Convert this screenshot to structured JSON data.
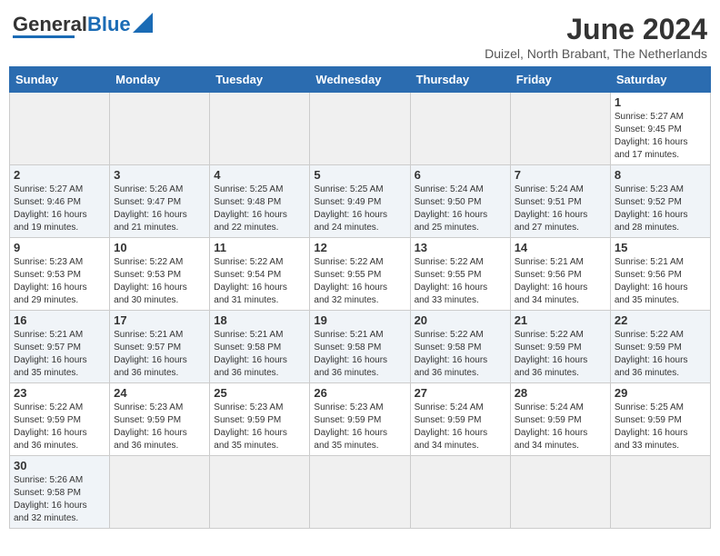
{
  "header": {
    "logo_general": "General",
    "logo_blue": "Blue",
    "month_year": "June 2024",
    "location": "Duizel, North Brabant, The Netherlands"
  },
  "weekdays": [
    "Sunday",
    "Monday",
    "Tuesday",
    "Wednesday",
    "Thursday",
    "Friday",
    "Saturday"
  ],
  "weeks": [
    [
      {
        "day": "",
        "info": ""
      },
      {
        "day": "",
        "info": ""
      },
      {
        "day": "",
        "info": ""
      },
      {
        "day": "",
        "info": ""
      },
      {
        "day": "",
        "info": ""
      },
      {
        "day": "",
        "info": ""
      },
      {
        "day": "1",
        "info": "Sunrise: 5:27 AM\nSunset: 9:45 PM\nDaylight: 16 hours\nand 17 minutes."
      }
    ],
    [
      {
        "day": "2",
        "info": "Sunrise: 5:27 AM\nSunset: 9:46 PM\nDaylight: 16 hours\nand 19 minutes."
      },
      {
        "day": "3",
        "info": "Sunrise: 5:26 AM\nSunset: 9:47 PM\nDaylight: 16 hours\nand 21 minutes."
      },
      {
        "day": "4",
        "info": "Sunrise: 5:25 AM\nSunset: 9:48 PM\nDaylight: 16 hours\nand 22 minutes."
      },
      {
        "day": "5",
        "info": "Sunrise: 5:25 AM\nSunset: 9:49 PM\nDaylight: 16 hours\nand 24 minutes."
      },
      {
        "day": "6",
        "info": "Sunrise: 5:24 AM\nSunset: 9:50 PM\nDaylight: 16 hours\nand 25 minutes."
      },
      {
        "day": "7",
        "info": "Sunrise: 5:24 AM\nSunset: 9:51 PM\nDaylight: 16 hours\nand 27 minutes."
      },
      {
        "day": "8",
        "info": "Sunrise: 5:23 AM\nSunset: 9:52 PM\nDaylight: 16 hours\nand 28 minutes."
      }
    ],
    [
      {
        "day": "9",
        "info": "Sunrise: 5:23 AM\nSunset: 9:53 PM\nDaylight: 16 hours\nand 29 minutes."
      },
      {
        "day": "10",
        "info": "Sunrise: 5:22 AM\nSunset: 9:53 PM\nDaylight: 16 hours\nand 30 minutes."
      },
      {
        "day": "11",
        "info": "Sunrise: 5:22 AM\nSunset: 9:54 PM\nDaylight: 16 hours\nand 31 minutes."
      },
      {
        "day": "12",
        "info": "Sunrise: 5:22 AM\nSunset: 9:55 PM\nDaylight: 16 hours\nand 32 minutes."
      },
      {
        "day": "13",
        "info": "Sunrise: 5:22 AM\nSunset: 9:55 PM\nDaylight: 16 hours\nand 33 minutes."
      },
      {
        "day": "14",
        "info": "Sunrise: 5:21 AM\nSunset: 9:56 PM\nDaylight: 16 hours\nand 34 minutes."
      },
      {
        "day": "15",
        "info": "Sunrise: 5:21 AM\nSunset: 9:56 PM\nDaylight: 16 hours\nand 35 minutes."
      }
    ],
    [
      {
        "day": "16",
        "info": "Sunrise: 5:21 AM\nSunset: 9:57 PM\nDaylight: 16 hours\nand 35 minutes."
      },
      {
        "day": "17",
        "info": "Sunrise: 5:21 AM\nSunset: 9:57 PM\nDaylight: 16 hours\nand 36 minutes."
      },
      {
        "day": "18",
        "info": "Sunrise: 5:21 AM\nSunset: 9:58 PM\nDaylight: 16 hours\nand 36 minutes."
      },
      {
        "day": "19",
        "info": "Sunrise: 5:21 AM\nSunset: 9:58 PM\nDaylight: 16 hours\nand 36 minutes."
      },
      {
        "day": "20",
        "info": "Sunrise: 5:22 AM\nSunset: 9:58 PM\nDaylight: 16 hours\nand 36 minutes."
      },
      {
        "day": "21",
        "info": "Sunrise: 5:22 AM\nSunset: 9:59 PM\nDaylight: 16 hours\nand 36 minutes."
      },
      {
        "day": "22",
        "info": "Sunrise: 5:22 AM\nSunset: 9:59 PM\nDaylight: 16 hours\nand 36 minutes."
      }
    ],
    [
      {
        "day": "23",
        "info": "Sunrise: 5:22 AM\nSunset: 9:59 PM\nDaylight: 16 hours\nand 36 minutes."
      },
      {
        "day": "24",
        "info": "Sunrise: 5:23 AM\nSunset: 9:59 PM\nDaylight: 16 hours\nand 36 minutes."
      },
      {
        "day": "25",
        "info": "Sunrise: 5:23 AM\nSunset: 9:59 PM\nDaylight: 16 hours\nand 35 minutes."
      },
      {
        "day": "26",
        "info": "Sunrise: 5:23 AM\nSunset: 9:59 PM\nDaylight: 16 hours\nand 35 minutes."
      },
      {
        "day": "27",
        "info": "Sunrise: 5:24 AM\nSunset: 9:59 PM\nDaylight: 16 hours\nand 34 minutes."
      },
      {
        "day": "28",
        "info": "Sunrise: 5:24 AM\nSunset: 9:59 PM\nDaylight: 16 hours\nand 34 minutes."
      },
      {
        "day": "29",
        "info": "Sunrise: 5:25 AM\nSunset: 9:59 PM\nDaylight: 16 hours\nand 33 minutes."
      }
    ],
    [
      {
        "day": "30",
        "info": "Sunrise: 5:26 AM\nSunset: 9:58 PM\nDaylight: 16 hours\nand 32 minutes."
      },
      {
        "day": "",
        "info": ""
      },
      {
        "day": "",
        "info": ""
      },
      {
        "day": "",
        "info": ""
      },
      {
        "day": "",
        "info": ""
      },
      {
        "day": "",
        "info": ""
      },
      {
        "day": "",
        "info": ""
      }
    ]
  ]
}
